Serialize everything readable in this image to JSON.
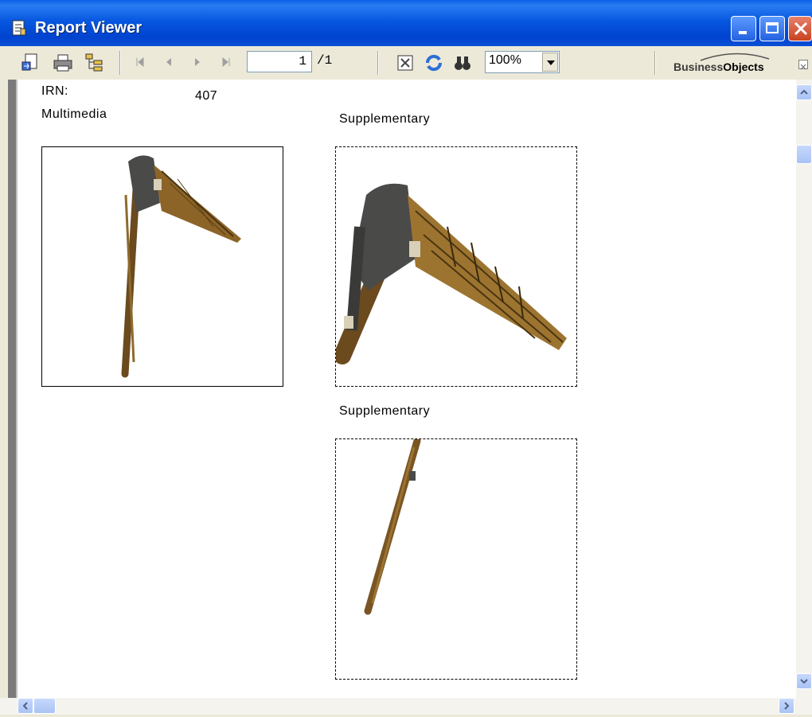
{
  "window": {
    "title": "Report Viewer"
  },
  "toolbar": {
    "page_current": "1",
    "page_total": "/1",
    "zoom": "100%",
    "brand_prefix": "Business",
    "brand_suffix": "Objects"
  },
  "report": {
    "irn_label": "IRN:",
    "irn_value": "407",
    "multimedia_label": "Multimedia",
    "supplementary_label_1": "Supplementary",
    "supplementary_label_2": "Supplementary"
  }
}
